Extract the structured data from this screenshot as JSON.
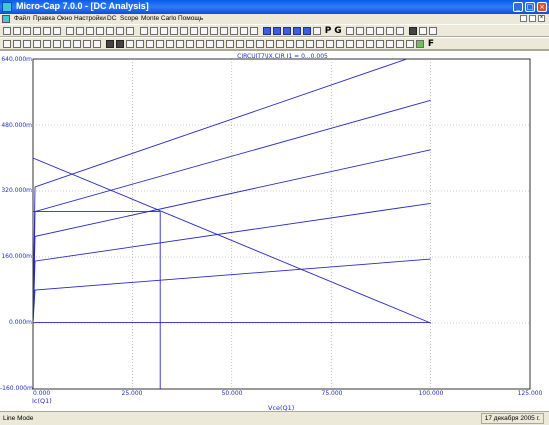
{
  "window": {
    "title": "Micro-Cap 7.0.0 - [DC Analysis]"
  },
  "menu": [
    "Файл",
    "Правка",
    "Окно",
    "Настройки",
    "DC",
    "Scope",
    "Monte Carlo",
    "Помощь"
  ],
  "toolbar": {
    "p_label": "P",
    "g_label": "G",
    "f_label": "F"
  },
  "plot": {
    "title": "CIRCUIT7\\IX.CIR  I1 = 0...0.005",
    "xaxis_name": "Vce(Q1)",
    "yaxis_name": "Ic(Q1)",
    "x_ticks": [
      "0.000",
      "25.000",
      "50.000",
      "75.000",
      "100.000",
      "125.000"
    ],
    "y_ticks": [
      "640.000m",
      "480.000m",
      "320.000m",
      "160.000m",
      "0.000m",
      "-160.000m"
    ]
  },
  "chart_data": {
    "type": "line",
    "title": "CIRCUIT7\\IX.CIR  I1 = 0...0.005",
    "xlabel": "Vce(Q1)",
    "ylabel": "Ic(Q1)",
    "xlim": [
      0,
      125
    ],
    "ylim": [
      -0.16,
      0.64
    ],
    "grid": true,
    "series": [
      {
        "x": [
          0,
          0.5,
          100
        ],
        "y": [
          0,
          0.001,
          0.001
        ]
      },
      {
        "x": [
          0,
          0.5,
          100
        ],
        "y": [
          0,
          0.08,
          0.155
        ]
      },
      {
        "x": [
          0,
          0.5,
          100
        ],
        "y": [
          0,
          0.15,
          0.29
        ]
      },
      {
        "x": [
          0,
          0.5,
          100
        ],
        "y": [
          0,
          0.21,
          0.42
        ]
      },
      {
        "x": [
          0,
          0.5,
          100
        ],
        "y": [
          0,
          0.27,
          0.54
        ]
      },
      {
        "x": [
          0,
          0.5,
          100
        ],
        "y": [
          0,
          0.33,
          0.66
        ]
      },
      {
        "x": [
          0,
          100
        ],
        "y": [
          0.4,
          0
        ]
      },
      {
        "x": [
          0,
          32
        ],
        "y": [
          0.27,
          0.27
        ]
      },
      {
        "x": [
          32,
          32
        ],
        "y": [
          0.27,
          -0.16
        ]
      }
    ]
  },
  "status": {
    "mode": "Line Mode",
    "date": "17 декабря 2005 г."
  }
}
